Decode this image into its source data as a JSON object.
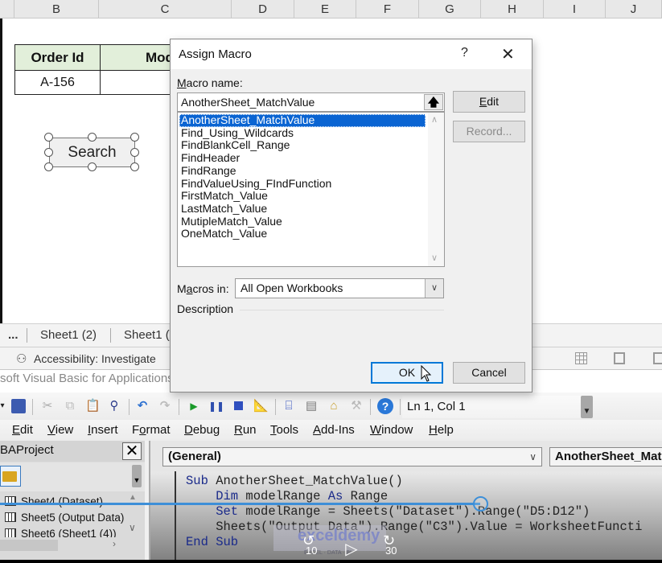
{
  "excel": {
    "columns": [
      "B",
      "C",
      "D",
      "E",
      "F",
      "G",
      "H",
      "I",
      "J"
    ],
    "table": {
      "headers": [
        "Order Id",
        "Mod"
      ],
      "rows": [
        [
          "A-156",
          ""
        ]
      ]
    },
    "search_button_label": "Search",
    "sheet_tabs": [
      "...",
      "Sheet1 (2)",
      "Sheet1 ("
    ],
    "status": {
      "accessibility": "Accessibility: Investigate"
    },
    "vba_window_title": "soft Visual Basic for Applications"
  },
  "dialog": {
    "title": "Assign Macro",
    "help_label": "?",
    "close_label": "✕",
    "macro_name_label_accel": "M",
    "macro_name_label_rest": "acro name:",
    "macro_name_value": "AnotherSheet_MatchValue",
    "macros": [
      "AnotherSheet_MatchValue",
      "Find_Using_Wildcards",
      "FindBlankCell_Range",
      "FindHeader",
      "FindRange",
      "FindValueUsing_FIndFunction",
      "FirstMatch_Value",
      "LastMatch_Value",
      "MutipleMatch_Value",
      "OneMatch_Value"
    ],
    "selected_macro": "AnotherSheet_MatchValue",
    "buttons": {
      "edit": "Edit",
      "record": "Record...",
      "ok": "OK",
      "cancel": "Cancel"
    },
    "macros_in_label_pre": "M",
    "macros_in_label_accel": "a",
    "macros_in_label_post": "cros in:",
    "macros_in_value": "All Open Workbooks",
    "description_label": "Description"
  },
  "vba": {
    "position_readout": "Ln 1, Col 1",
    "menu": [
      {
        "accel": "E",
        "rest": "dit"
      },
      {
        "accel": "V",
        "rest": "iew"
      },
      {
        "accel": "I",
        "rest": "nsert"
      },
      {
        "pre": "F",
        "accel": "o",
        "rest": "rmat"
      },
      {
        "accel": "D",
        "rest": "ebug"
      },
      {
        "accel": "R",
        "rest": "un"
      },
      {
        "accel": "T",
        "rest": "ools"
      },
      {
        "accel": "A",
        "rest": "dd-Ins"
      },
      {
        "accel": "W",
        "rest": "indow"
      },
      {
        "accel": "H",
        "rest": "elp"
      }
    ],
    "project": {
      "title": "BAProject",
      "close_label": "✕",
      "items": [
        "Sheet4 (Dataset)",
        "Sheet5 (Output Data)",
        "Sheet6 (Sheet1 (4))"
      ]
    },
    "object_combo": "(General)",
    "procedure_combo": "AnotherSheet_Matc",
    "code": [
      {
        "kw": "Sub ",
        "text": "AnotherSheet_MatchValue()"
      },
      {
        "kw": "    Dim ",
        "text": "modelRange ",
        "kw2": "As ",
        "text2": "Range"
      },
      {
        "kw": "    Set ",
        "text": "modelRange = Sheets(\"Dataset\").Range(\"D5:D12\")"
      },
      {
        "kw": "",
        "text": "    Sheets(\"Output Data\").Range(\"C3\").Value = WorksheetFuncti"
      },
      {
        "kw": "End Sub",
        "text": ""
      }
    ]
  },
  "video": {
    "progress_fraction": 0.725,
    "rewind_label": "10",
    "forward_label": "30",
    "watermark": "exceldemy",
    "watermark_sub": "EXCEL · DATA · BI"
  }
}
